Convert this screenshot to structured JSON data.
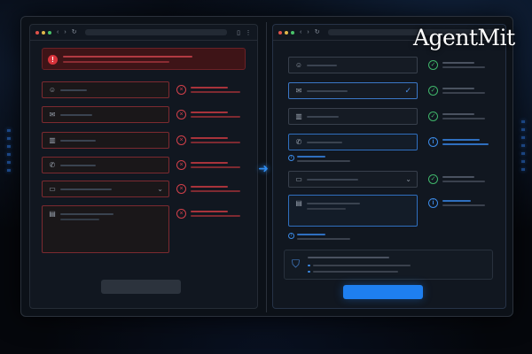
{
  "brand": {
    "logo_text": "AgentMit"
  },
  "colors": {
    "error": "#d2404a",
    "success": "#3fb56a",
    "info": "#3b8ae6",
    "primary": "#1e7ff0",
    "background": "#05070c"
  },
  "browser_bar": {
    "nav_back": "‹",
    "nav_forward": "›",
    "nav_reload": "↻",
    "bookmark_icon": "bookmark-icon",
    "menu_icon": "more-vertical-icon"
  },
  "left_form": {
    "state": "error",
    "error_banner": {
      "icon": "error-circle-icon",
      "badge": "!"
    },
    "fields": [
      {
        "icon": "user-icon",
        "glyph": "☺",
        "status": "error",
        "status_glyph": "×"
      },
      {
        "icon": "mail-icon",
        "glyph": "✉",
        "status": "error",
        "status_glyph": "×"
      },
      {
        "icon": "building-icon",
        "glyph": "▥",
        "status": "error",
        "status_glyph": "×"
      },
      {
        "icon": "phone-icon",
        "glyph": "✆",
        "status": "error",
        "status_glyph": "×"
      },
      {
        "icon": "dropdown-icon",
        "glyph": "▭",
        "status": "error",
        "status_glyph": "×",
        "chevron": "⌄"
      },
      {
        "icon": "message-icon",
        "glyph": "▤",
        "status": "error",
        "status_glyph": "×"
      }
    ],
    "submit": {
      "state": "disabled"
    }
  },
  "right_form": {
    "state": "valid",
    "fields": [
      {
        "icon": "user-icon",
        "glyph": "☺",
        "status": "success",
        "status_glyph": "✓"
      },
      {
        "icon": "mail-icon",
        "glyph": "✉",
        "status": "success",
        "status_glyph": "✓",
        "inner_check": "✓"
      },
      {
        "icon": "building-icon",
        "glyph": "▥",
        "status": "success",
        "status_glyph": "✓"
      },
      {
        "icon": "phone-icon",
        "glyph": "✆",
        "status": "info",
        "status_glyph": "i"
      },
      {
        "icon": "dropdown-icon",
        "glyph": "▭",
        "status": "success",
        "status_glyph": "✓",
        "chevron": "⌄"
      },
      {
        "icon": "message-icon",
        "glyph": "▤",
        "status": "info",
        "status_glyph": "i"
      }
    ],
    "hint_glyph": "i",
    "security_card": {
      "icon": "shield-check-icon",
      "glyph": "⛉"
    },
    "submit": {
      "state": "enabled"
    }
  },
  "transition_arrow": {
    "glyph": "➜"
  }
}
